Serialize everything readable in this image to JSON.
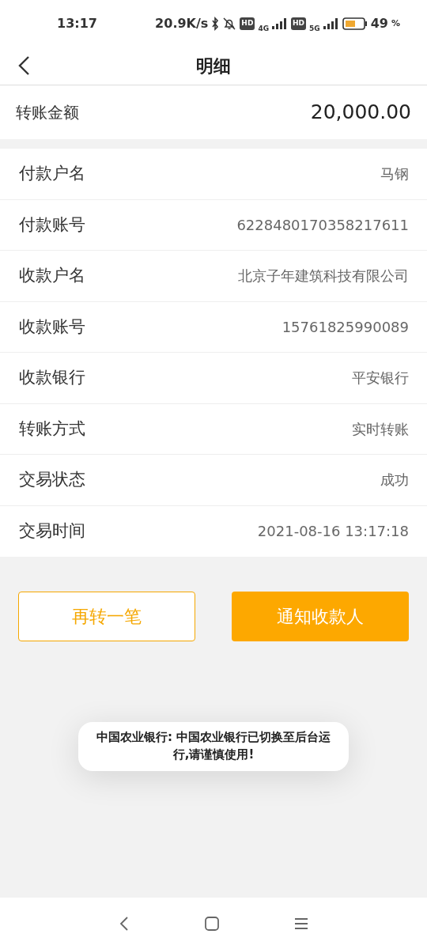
{
  "status_bar": {
    "time": "13:17",
    "speed": "20.9K/s",
    "sim1": {
      "hd": "HD",
      "network": "4G"
    },
    "sim2": {
      "hd": "HD",
      "network": "5G"
    },
    "battery": "49",
    "battery_unit": "%"
  },
  "header": {
    "title": "明细"
  },
  "amount": {
    "label": "转账金额",
    "value": "20,000.00"
  },
  "details": [
    {
      "label": "付款户名",
      "value": "马钢"
    },
    {
      "label": "付款账号",
      "value": "6228480170358217611"
    },
    {
      "label": "收款户名",
      "value": "北京子年建筑科技有限公司"
    },
    {
      "label": "收款账号",
      "value": "15761825990089"
    },
    {
      "label": "收款银行",
      "value": "平安银行"
    },
    {
      "label": "转账方式",
      "value": "实时转账"
    },
    {
      "label": "交易状态",
      "value": "成功"
    },
    {
      "label": "交易时间",
      "value": "2021-08-16 13:17:18"
    }
  ],
  "buttons": [
    {
      "label": "再转一笔",
      "kind": "outline"
    },
    {
      "label": "通知收款人",
      "kind": "filled"
    }
  ],
  "toast": "中国农业银行: 中国农业银行已切换至后台运行,请谨慎使用!"
}
